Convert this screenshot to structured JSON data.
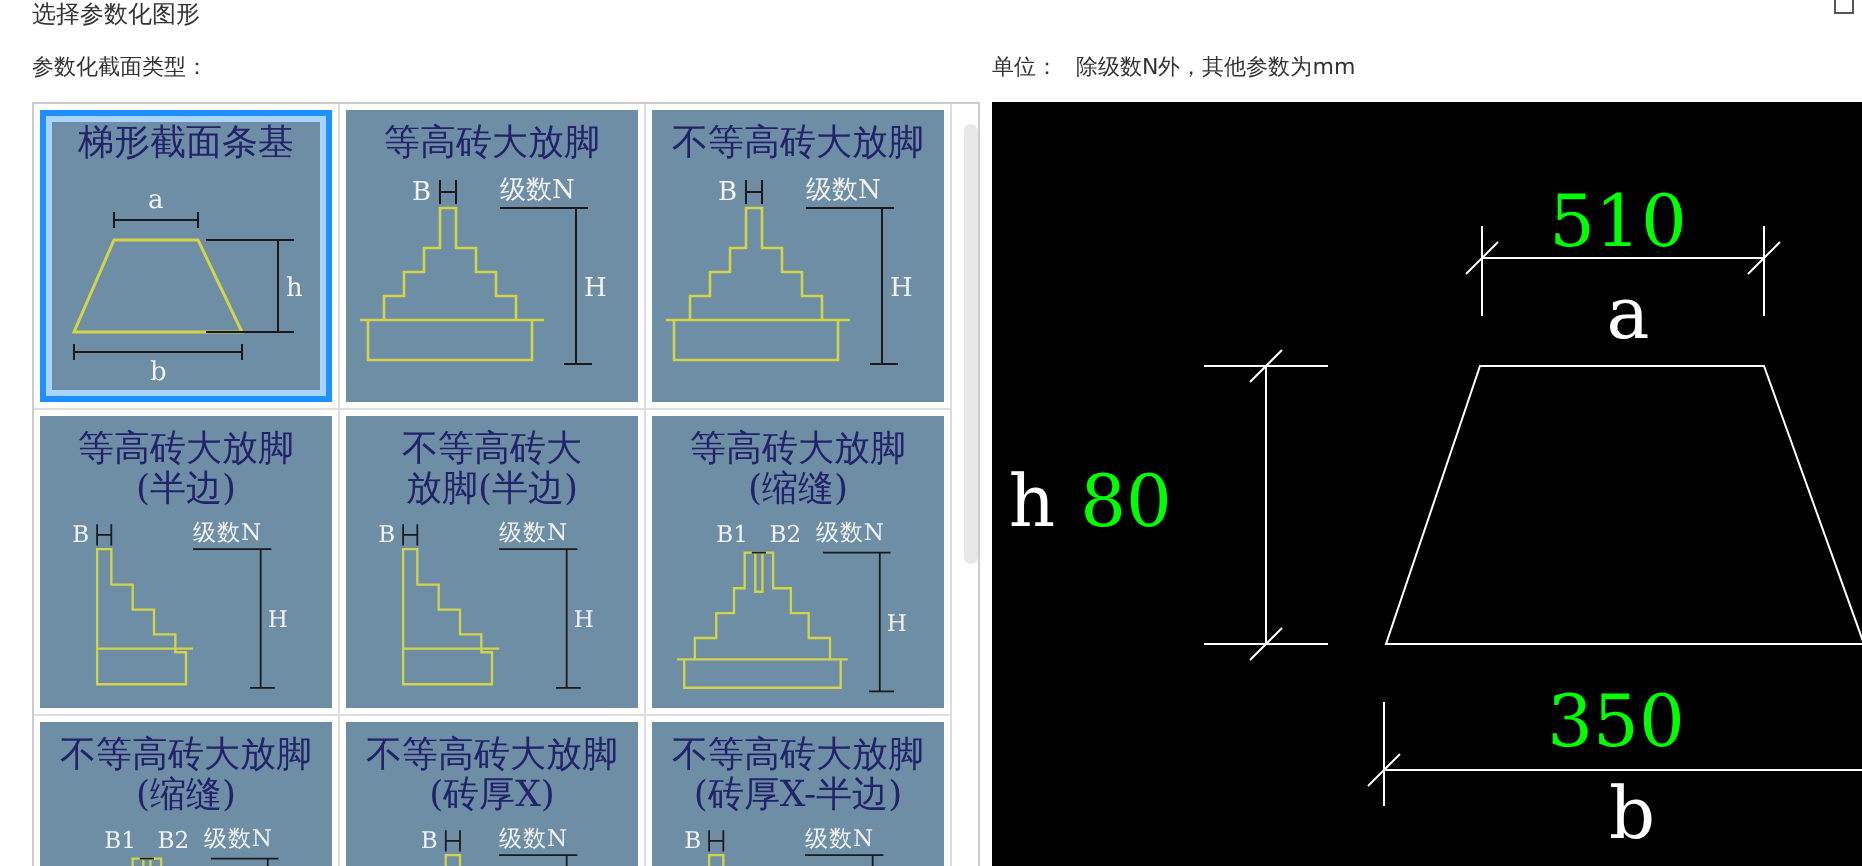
{
  "window": {
    "title": "选择参数化图形"
  },
  "section_label": "参数化截面类型：",
  "unit": {
    "label": "单位：",
    "text": "除级数N外，其他参数为mm"
  },
  "tiles": [
    {
      "title_lines": [
        "梯形截面条基"
      ],
      "kind": "trapezoid",
      "labels": [
        "a",
        "h",
        "b"
      ],
      "selected": true
    },
    {
      "title_lines": [
        "等高砖大放脚"
      ],
      "kind": "stepped",
      "labels": [
        "B",
        "级数N",
        "H"
      ],
      "selected": false
    },
    {
      "title_lines": [
        "不等高砖大放脚"
      ],
      "kind": "stepped",
      "labels": [
        "B",
        "级数N",
        "H"
      ],
      "selected": false
    },
    {
      "title_lines": [
        "等高砖大放脚",
        "(半边)"
      ],
      "kind": "half",
      "labels": [
        "B",
        "级数N",
        "H"
      ],
      "selected": false
    },
    {
      "title_lines": [
        "不等高砖大",
        "放脚(半边)"
      ],
      "kind": "half",
      "labels": [
        "B",
        "级数N",
        "H"
      ],
      "selected": false
    },
    {
      "title_lines": [
        "等高砖大放脚",
        "(缩缝)"
      ],
      "kind": "joint",
      "labels": [
        "B1",
        "B2",
        "级数N",
        "H"
      ],
      "selected": false
    },
    {
      "title_lines": [
        "不等高砖大放脚",
        "(缩缝)"
      ],
      "kind": "joint",
      "labels": [
        "B1",
        "B2",
        "级数N"
      ],
      "selected": false
    },
    {
      "title_lines": [
        "不等高砖大放脚",
        "(砖厚X)"
      ],
      "kind": "stepped",
      "labels": [
        "B",
        "级数N"
      ],
      "selected": false
    },
    {
      "title_lines": [
        "不等高砖大放脚",
        "(砖厚X-半边)"
      ],
      "kind": "half",
      "labels": [
        "B",
        "级数N"
      ],
      "selected": false
    }
  ],
  "preview": {
    "top_value": "510",
    "top_label": "a",
    "left_label": "h",
    "left_value": "80",
    "bottom_value": "350",
    "bottom_label": "b"
  }
}
